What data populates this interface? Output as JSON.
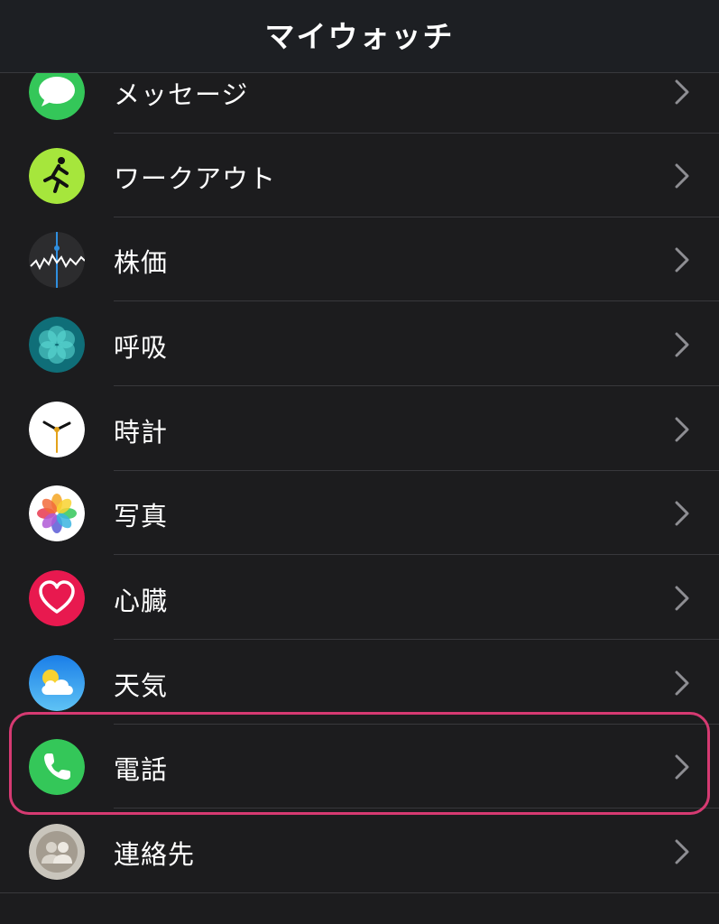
{
  "header": {
    "title": "マイウォッチ"
  },
  "rows": [
    {
      "label": "メッセージ",
      "icon": "messages-icon"
    },
    {
      "label": "ワークアウト",
      "icon": "workout-icon"
    },
    {
      "label": "株価",
      "icon": "stocks-icon"
    },
    {
      "label": "呼吸",
      "icon": "breathe-icon"
    },
    {
      "label": "時計",
      "icon": "clock-icon"
    },
    {
      "label": "写真",
      "icon": "photos-icon"
    },
    {
      "label": "心臓",
      "icon": "heart-icon"
    },
    {
      "label": "天気",
      "icon": "weather-icon"
    },
    {
      "label": "電話",
      "icon": "phone-icon",
      "highlighted": true
    },
    {
      "label": "連絡先",
      "icon": "contacts-icon"
    }
  ],
  "colors": {
    "background": "#1c1c1e",
    "highlight_border": "#d63a72",
    "separator": "#38383c",
    "chevron": "#8e8e93"
  }
}
